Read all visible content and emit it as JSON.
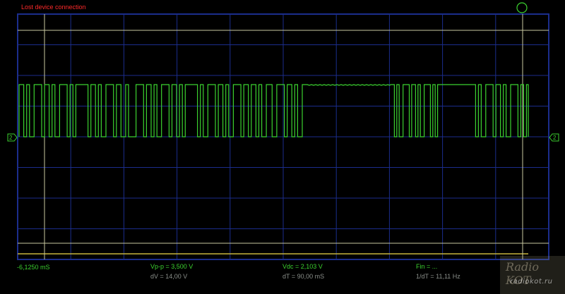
{
  "status": {
    "message": "Lost device connection"
  },
  "readouts": {
    "cursor_time": "-6,1250 mS",
    "vpp": "Vp-p = 3,500 V",
    "dv": "dV = 14,00 V",
    "vdc": "Vdc = 2,103 V",
    "dt": "dT = 90,00 mS",
    "fin": "Fin = ...",
    "inv_dt": "1/dT = 11,11 Hz"
  },
  "trigger": {
    "channel": "2"
  },
  "watermark": {
    "line1": "Radio KOT",
    "line2": "radiokot.ru"
  },
  "colors": {
    "trace": "#3bd12f",
    "grid": "#1b2d8c",
    "cursor": "#c8c8a0",
    "warning": "#ff2a2a"
  },
  "signal": {
    "description_levels": [
      "high",
      "low"
    ],
    "burst_pattern": [
      1,
      0,
      1,
      0,
      1,
      1,
      0,
      1,
      0,
      1,
      0,
      1,
      1,
      0,
      1,
      0,
      1,
      1,
      1,
      0,
      1,
      0,
      1,
      0,
      1,
      1,
      0,
      1,
      0,
      1,
      0,
      0,
      1,
      1,
      0,
      1,
      0,
      1,
      0,
      1,
      1,
      0,
      1,
      0,
      1,
      0,
      1,
      1,
      1,
      0,
      1,
      0,
      1,
      1,
      0,
      1,
      0,
      1,
      0,
      1,
      1,
      0,
      1,
      0,
      1,
      0,
      1,
      0,
      1,
      1,
      0,
      1,
      1,
      0,
      1,
      0,
      1,
      0,
      1,
      1,
      0,
      1,
      0,
      1,
      0,
      1,
      1,
      0,
      1,
      0,
      1,
      0,
      1,
      1,
      1,
      0,
      1,
      0,
      1,
      0,
      1,
      0,
      1,
      1,
      0,
      1,
      0,
      1,
      0,
      1,
      1,
      0,
      1,
      0,
      1,
      0,
      1,
      0,
      1,
      1,
      0,
      1,
      0,
      1,
      0,
      1,
      1,
      0,
      1,
      0,
      1,
      0,
      1,
      1,
      0,
      1,
      0,
      1,
      0,
      1,
      1,
      0,
      1
    ]
  }
}
